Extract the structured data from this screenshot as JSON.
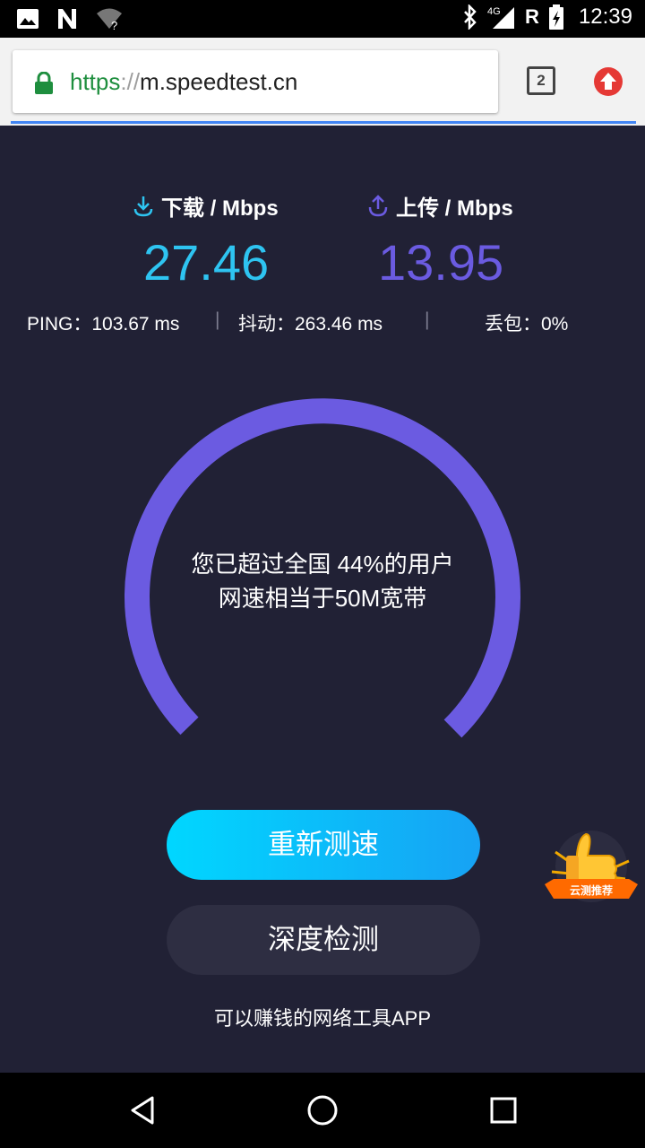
{
  "status_bar": {
    "time": "12:39",
    "network": "4G",
    "roaming": "R",
    "icons": [
      "image-icon",
      "n-notification-icon",
      "wifi-unknown-icon",
      "bluetooth-icon",
      "signal-icon",
      "battery-charging-icon"
    ]
  },
  "browser": {
    "url_scheme": "https",
    "url_separator": "://",
    "url_host": "m.speedtest.cn",
    "tab_count": "2",
    "accent": "#1e8e3e"
  },
  "speed": {
    "download_label": "下载 / Mbps",
    "download_value": "27.46",
    "upload_label": "上传 / Mbps",
    "upload_value": "13.95",
    "download_color": "#2ec4f1",
    "upload_color": "#6b5be1"
  },
  "metrics": {
    "ping": "PING：103.67 ms",
    "jitter": "抖动：263.46 ms",
    "loss": "丢包：0%",
    "separator": "|"
  },
  "gauge": {
    "line1": "您已超过全国 44%的用户",
    "line2": "网速相当于50M宽带",
    "color": "#6b5be1"
  },
  "buttons": {
    "retest": "重新测速",
    "deep_check": "深度检测"
  },
  "footer": "可以赚钱的网络工具APP",
  "badge": {
    "label": "云测推荐",
    "icon": "thumbs-up-icon"
  },
  "colors": {
    "page_bg": "#212135",
    "primary_button": "#00d7ff"
  }
}
